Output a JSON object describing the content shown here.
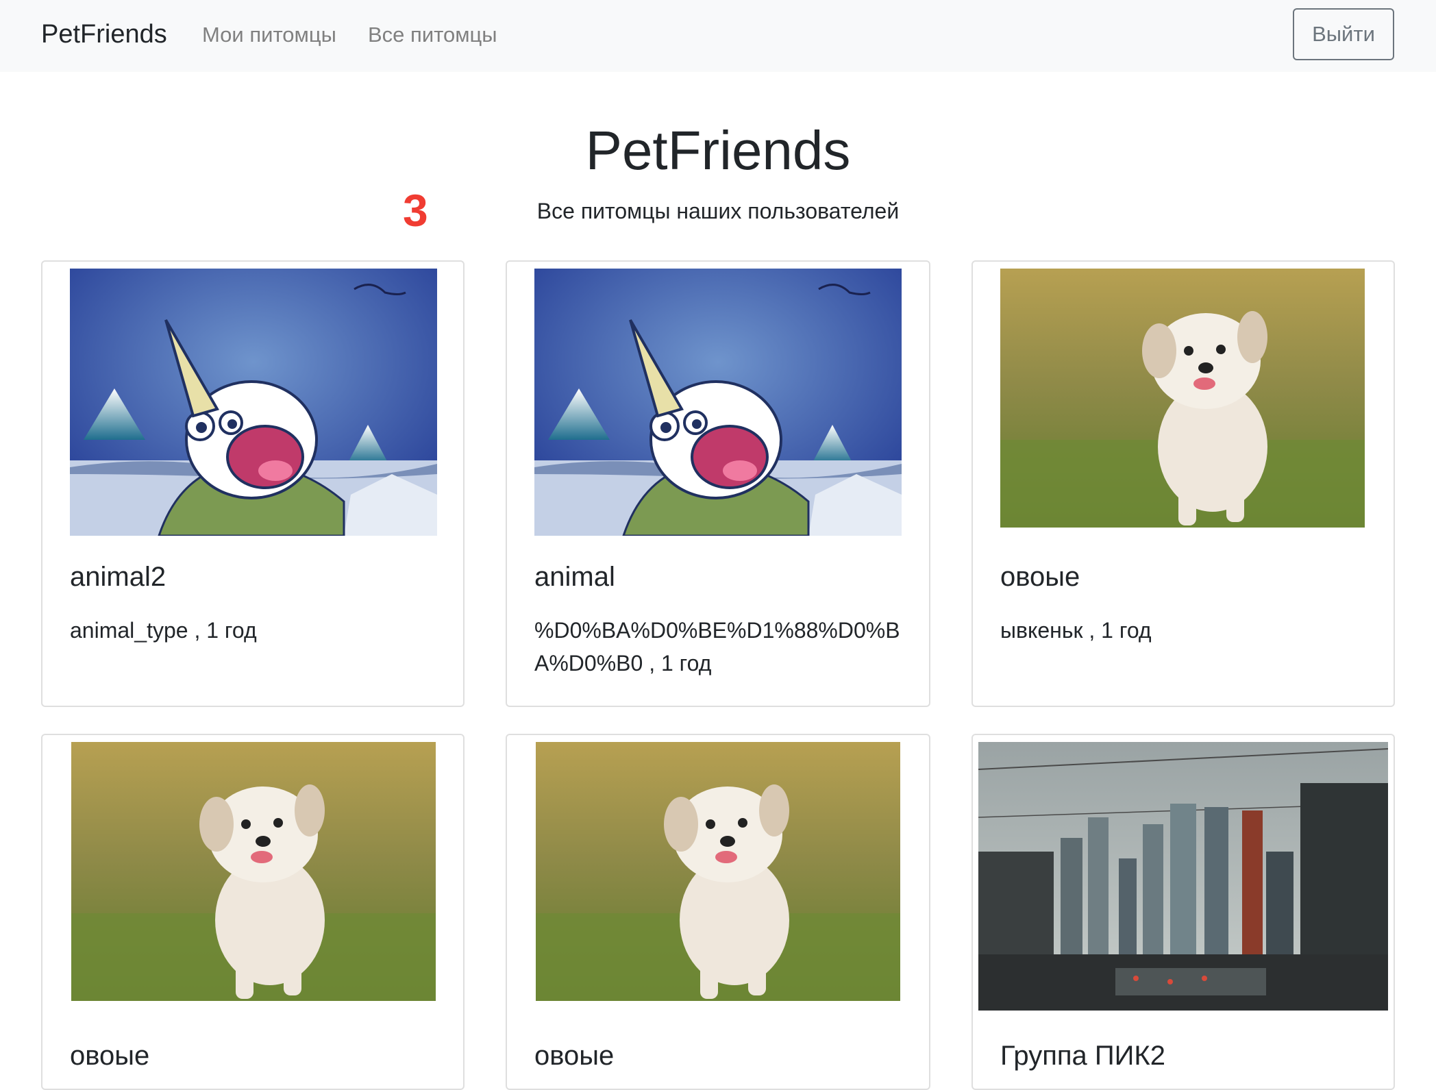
{
  "navbar": {
    "brand": "PetFriends",
    "links": [
      "Мои питомцы",
      "Все питомцы"
    ],
    "logout": "Выйти"
  },
  "header": {
    "title": "PetFriends",
    "subtitle": "Все питомцы наших пользователей",
    "annotation": "3"
  },
  "pets": [
    {
      "name": "animal2",
      "info": "animal_type , 1 год",
      "image": "narwhal-cartoon"
    },
    {
      "name": "animal",
      "info": "%D0%BA%D0%BE%D1%88%D0%BA%D0%B0 , 1 год",
      "image": "narwhal-cartoon"
    },
    {
      "name": "овоые",
      "info": "ывкеньк , 1 год",
      "image": "puppy-photo"
    },
    {
      "name": "овоые",
      "info": "",
      "image": "puppy-photo"
    },
    {
      "name": "овоые",
      "info": "",
      "image": "puppy-photo"
    },
    {
      "name": "Группа ПИК2",
      "info": "",
      "image": "city-photo"
    }
  ],
  "colors": {
    "navbar_bg": "#f8f9fa",
    "nav_link": "#808080",
    "annotation": "#f03c32",
    "card_border": "#dfdfdf"
  }
}
